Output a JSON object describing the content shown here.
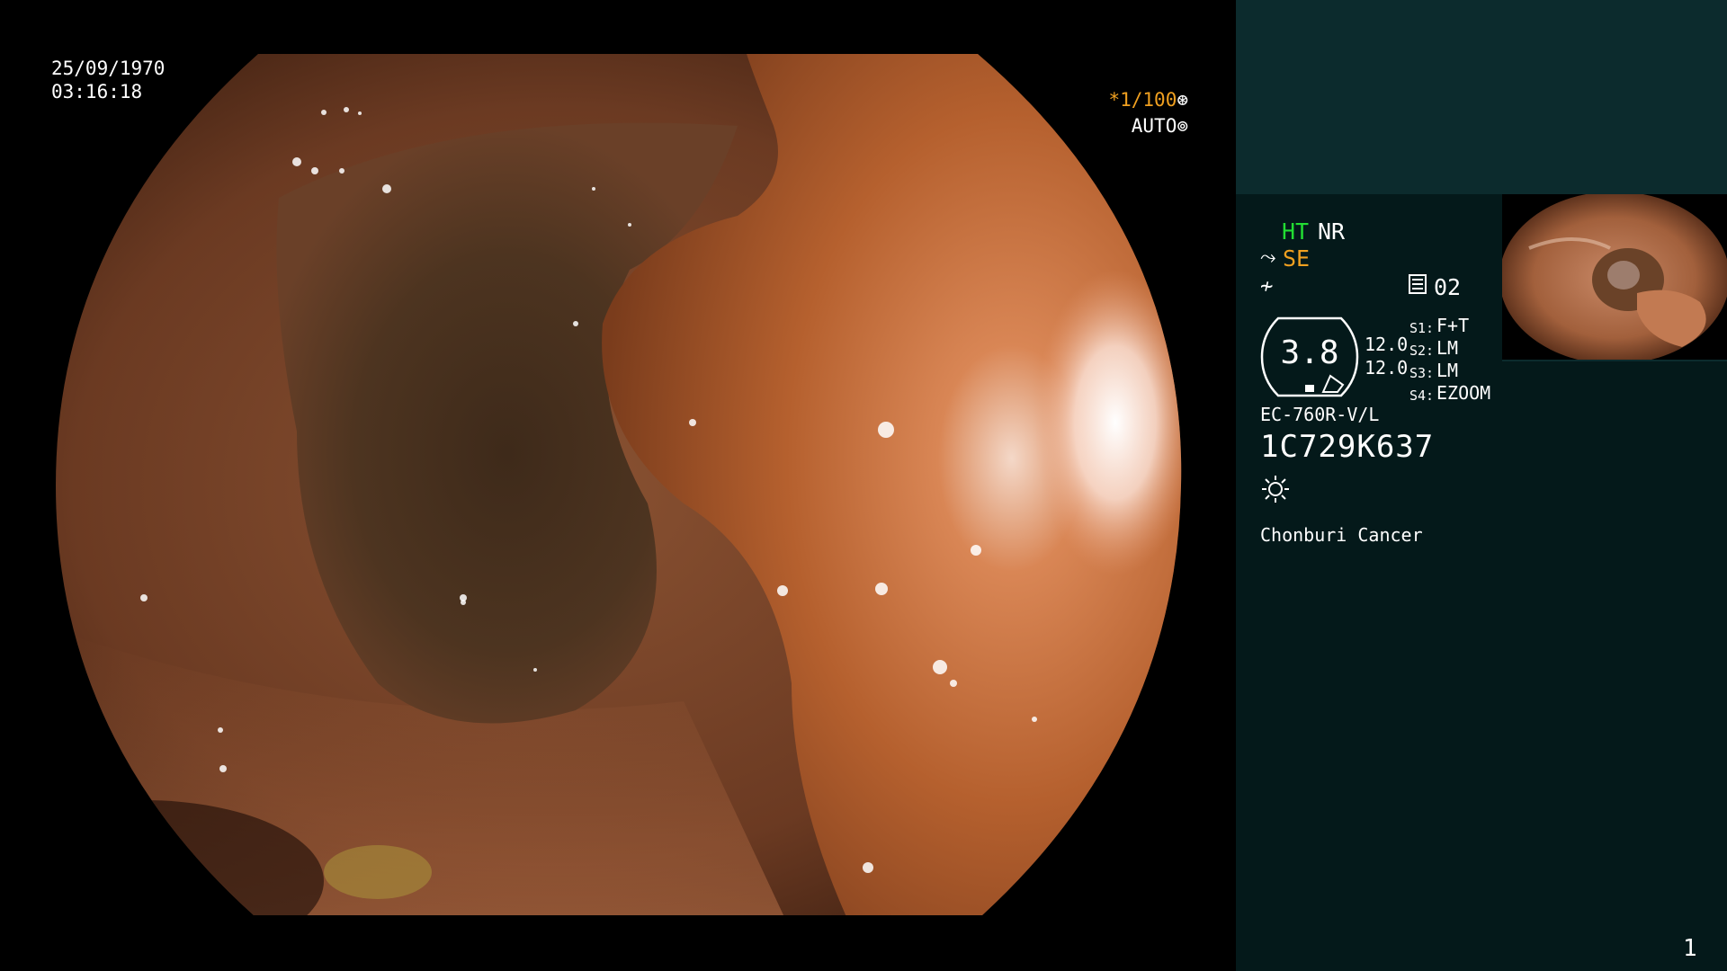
{
  "osd": {
    "date": "25/09/1970",
    "time": "03:16:18",
    "shutter": "*1/100",
    "exposure": "AUTO",
    "shutter_icon": "aperture-icon",
    "exposure_icon": "iris-icon"
  },
  "panel": {
    "ht": "HT",
    "nr": "NR",
    "se": "SE",
    "se_icon": "scope-angle-icon",
    "curve_icon": "curve-icon",
    "memory_icon": "memory-card-icon",
    "memory_number": "02",
    "zoom_value": "3.8",
    "value_1": "12.0",
    "value_2": "12.0",
    "switches": [
      {
        "label": "S1:",
        "value": "F+T"
      },
      {
        "label": "S2:",
        "value": "LM"
      },
      {
        "label": "S3:",
        "value": "LM"
      },
      {
        "label": "S4:",
        "value": "EZOOM"
      }
    ],
    "scope_model": "EC-760R-V/L",
    "serial_number": "1C729K637",
    "light_icon": "light-source-icon",
    "facility": "Chonburi Cancer",
    "page_number": "1"
  },
  "colors": {
    "ht_green": "#22dd33",
    "accent_orange": "#f0a020",
    "panel_bg": "#04191a",
    "panel_top_bg": "#0c2b2d"
  }
}
